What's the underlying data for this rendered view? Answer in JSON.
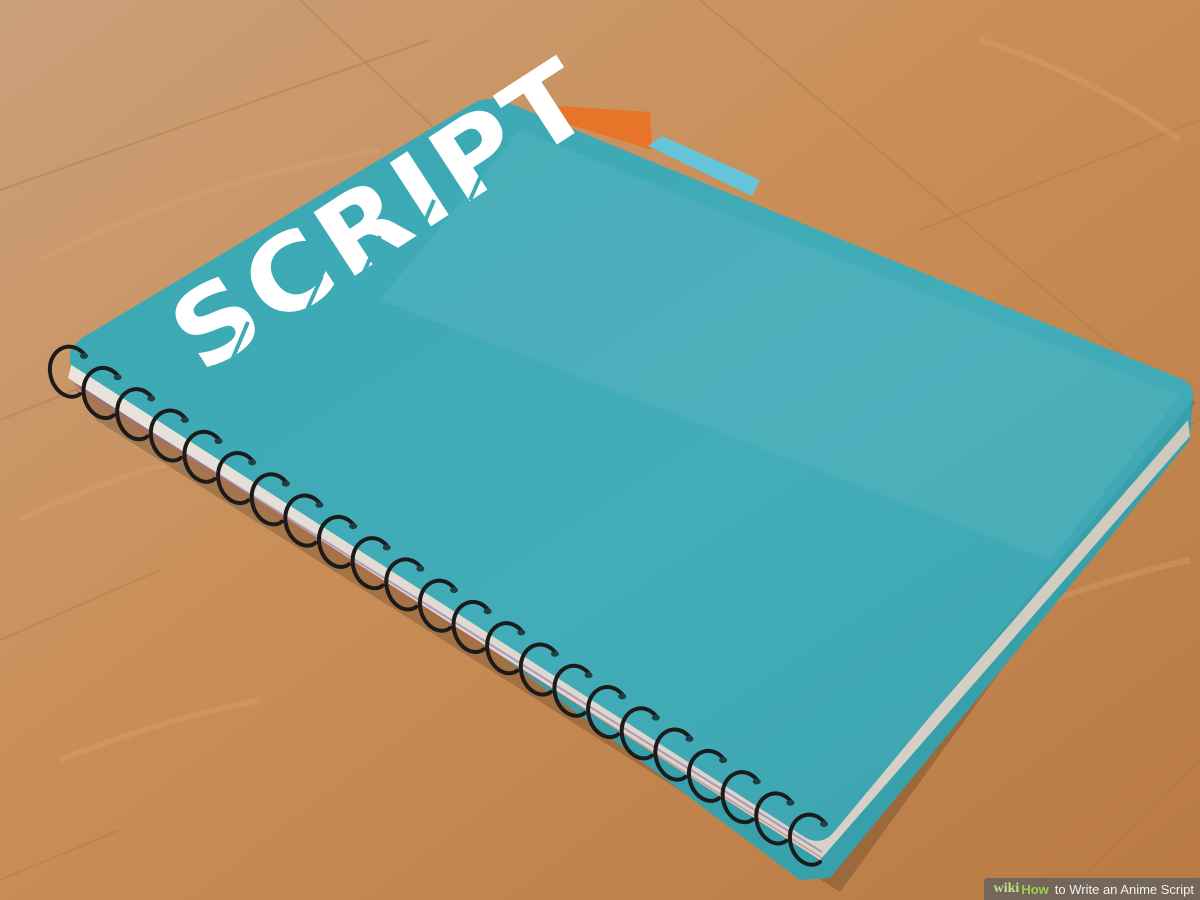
{
  "cover_text": "SCRIPT",
  "watermark": {
    "brand_wiki": "wiki",
    "brand_how": "How",
    "title": "to Write an Anime Script"
  },
  "colors": {
    "floor": "#c78e56",
    "cover": "#3eaab5",
    "tab_orange": "#e8742a",
    "tab_blue": "#66c4d8",
    "spiral": "#1b1b1b",
    "text": "#ffffff"
  }
}
